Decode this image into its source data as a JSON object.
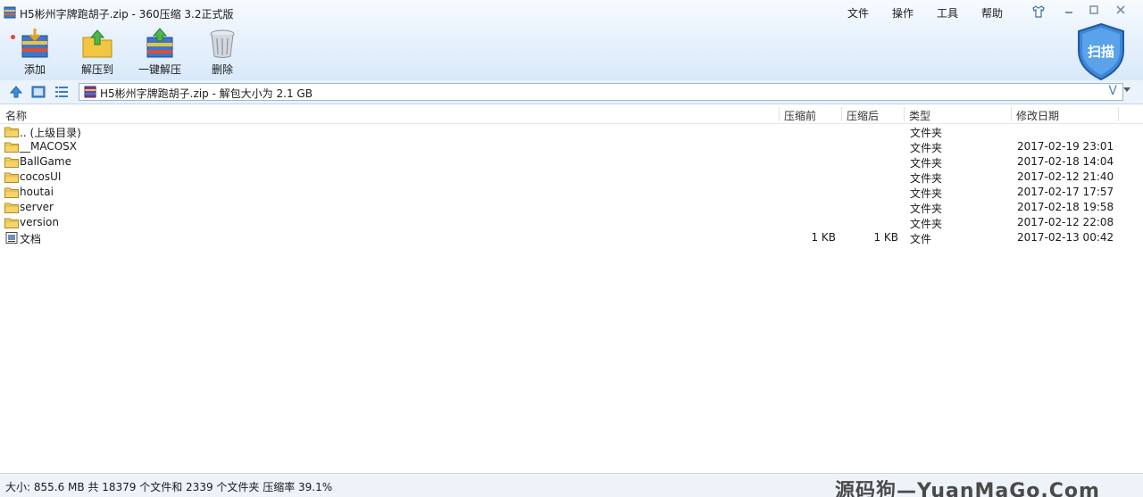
{
  "window": {
    "title": "H5彬州字牌跑胡子.zip - 360压缩 3.2正式版",
    "menu": [
      "文件",
      "操作",
      "工具",
      "帮助"
    ]
  },
  "toolbar": {
    "items": [
      {
        "label": "添加",
        "icon": "add-archive-icon"
      },
      {
        "label": "解压到",
        "icon": "extract-to-icon"
      },
      {
        "label": "一键解压",
        "icon": "one-click-extract-icon"
      },
      {
        "label": "删除",
        "icon": "delete-icon"
      }
    ],
    "scan_label": "扫描"
  },
  "address": {
    "path": "H5彬州字牌跑胡子.zip - 解包大小为 2.1 GB",
    "v_glyph": "V"
  },
  "columns": {
    "name": "名称",
    "before": "压缩前",
    "after": "压缩后",
    "type": "类型",
    "modified": "修改日期"
  },
  "files": [
    {
      "name": ".. (上级目录)",
      "before": "",
      "after": "",
      "type": "文件夹",
      "modified": "",
      "icon": "folder-icon"
    },
    {
      "name": "__MACOSX",
      "before": "",
      "after": "",
      "type": "文件夹",
      "modified": "2017-02-19 23:01",
      "icon": "folder-icon"
    },
    {
      "name": "BallGame",
      "before": "",
      "after": "",
      "type": "文件夹",
      "modified": "2017-02-18 14:04",
      "icon": "folder-icon"
    },
    {
      "name": "cocosUI",
      "before": "",
      "after": "",
      "type": "文件夹",
      "modified": "2017-02-12 21:40",
      "icon": "folder-icon"
    },
    {
      "name": "houtai",
      "before": "",
      "after": "",
      "type": "文件夹",
      "modified": "2017-02-17 17:57",
      "icon": "folder-icon"
    },
    {
      "name": "server",
      "before": "",
      "after": "",
      "type": "文件夹",
      "modified": "2017-02-18 19:58",
      "icon": "folder-icon"
    },
    {
      "name": "version",
      "before": "",
      "after": "",
      "type": "文件夹",
      "modified": "2017-02-12 22:08",
      "icon": "folder-icon"
    },
    {
      "name": "文档",
      "before": "1 KB",
      "after": "1 KB",
      "type": "文件",
      "modified": "2017-02-13 00:42",
      "icon": "file-icon"
    }
  ],
  "status": {
    "text": "大小: 855.6 MB 共 18379 个文件和 2339 个文件夹 压缩率 39.1%",
    "watermark": "源码狗—YuanMaGo.Com"
  }
}
